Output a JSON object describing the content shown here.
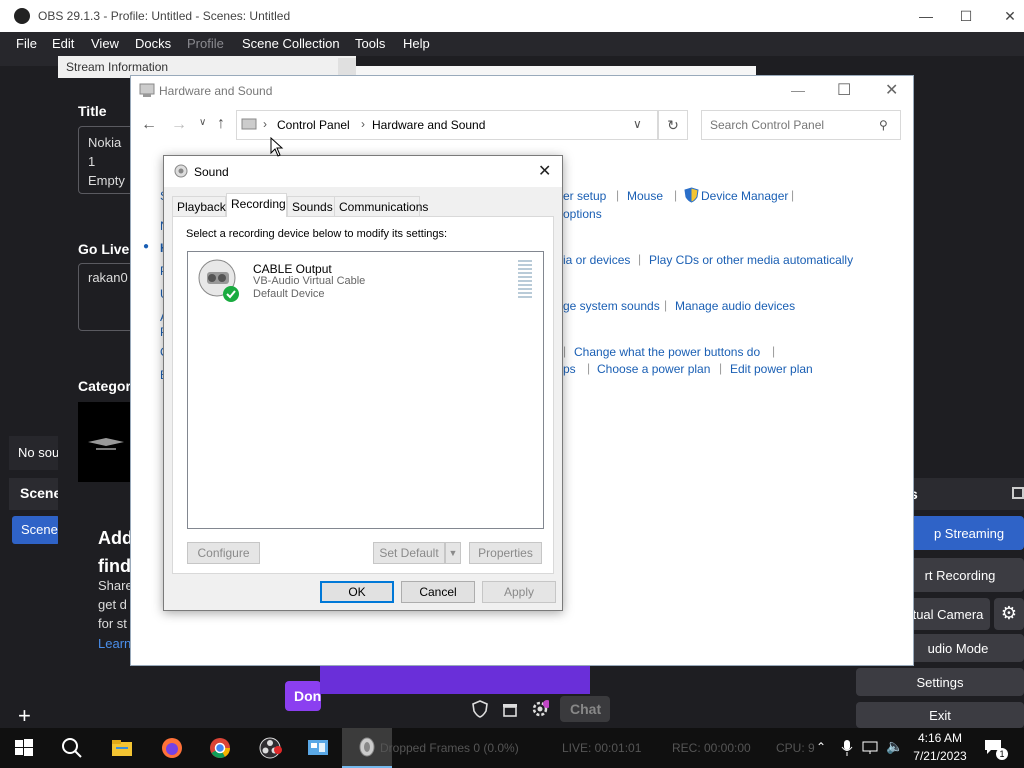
{
  "obs": {
    "title": "OBS 29.1.3 - Profile: Untitled - Scenes: Untitled",
    "menu": [
      "File",
      "Edit",
      "View",
      "Docks",
      "Profile",
      "Scene Collection",
      "Tools",
      "Help"
    ],
    "stream_info_title": "Stream Information",
    "title_label": "Title",
    "title_value": "Nokia 1\nEmpty",
    "go_live_label": "Go Live N",
    "go_live_value": "rakan0",
    "category_label": "Categor",
    "no_source": "No sou",
    "scenes_header": "Scene",
    "scene_item": "Scene",
    "promo_title": "Add\nfind",
    "promo_body": "Share\nget d\nfor st",
    "promo_link": "Learn",
    "done_button": "Don",
    "chat_label": "Chat",
    "controls_header": "s",
    "stop_streaming": "p Streaming",
    "start_recording": "rt Recording",
    "virtual_camera": "tual Camera",
    "studio_mode": "udio Mode",
    "settings": "Settings",
    "exit": "Exit",
    "status": {
      "dropped_frames": "Dropped Frames 0 (0.0%)",
      "live": "LIVE: 00:01:01",
      "rec": "REC: 00:00:00",
      "cpu": "CPU: 9"
    }
  },
  "control_panel": {
    "title": "Hardware and Sound",
    "breadcrumb": [
      "Control Panel",
      "Hardware and Sound"
    ],
    "search_placeholder": "Search Control Panel",
    "links": {
      "row1": [
        "er setup",
        "Mouse",
        "Device Manager"
      ],
      "row1b": "options",
      "row2": [
        "ia or devices",
        "Play CDs or other media automatically"
      ],
      "row3": [
        "ge system sounds",
        "Manage audio devices"
      ],
      "row4": [
        "Change what the power buttons do"
      ],
      "row5": [
        "ps",
        "Choose a power plan",
        "Edit power plan"
      ]
    },
    "left_letters": [
      "C",
      "S",
      "N",
      "H",
      "P",
      "U",
      "A",
      "P",
      "C",
      "E"
    ]
  },
  "sound_dialog": {
    "title": "Sound",
    "tabs": [
      "Playback",
      "Recording",
      "Sounds",
      "Communications"
    ],
    "active_tab": "Recording",
    "instruction": "Select a recording device below to modify its settings:",
    "devices": [
      {
        "name": "CABLE Output",
        "driver": "VB-Audio Virtual Cable",
        "status": "Default Device"
      }
    ],
    "buttons": {
      "configure": "Configure",
      "set_default": "Set Default",
      "properties": "Properties",
      "ok": "OK",
      "cancel": "Cancel",
      "apply": "Apply"
    }
  },
  "taskbar": {
    "time": "4:16 AM",
    "date": "7/21/2023"
  }
}
